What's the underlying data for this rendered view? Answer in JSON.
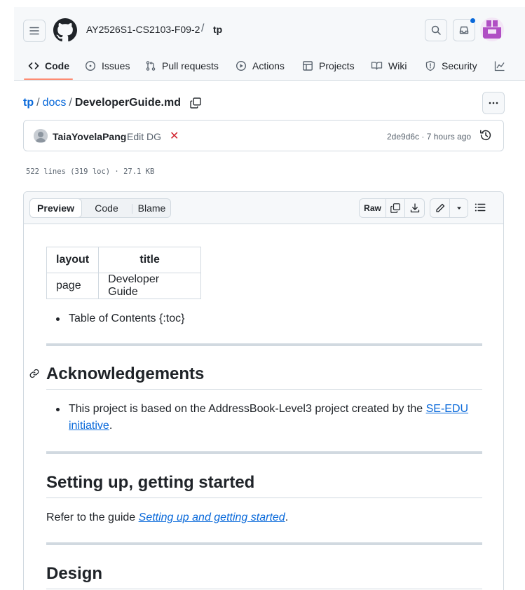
{
  "header": {
    "repo_owner": "AY2526S1-CS2103-F09-2",
    "repo_sep": "/",
    "repo_name": "tp"
  },
  "nav": {
    "tabs": [
      {
        "label": "Code",
        "icon": "code-icon",
        "active": true
      },
      {
        "label": "Issues",
        "icon": "issue-icon"
      },
      {
        "label": "Pull requests",
        "icon": "pull-request-icon"
      },
      {
        "label": "Actions",
        "icon": "play-icon"
      },
      {
        "label": "Projects",
        "icon": "table-icon"
      },
      {
        "label": "Wiki",
        "icon": "book-icon"
      },
      {
        "label": "Security",
        "icon": "shield-icon"
      }
    ]
  },
  "breadcrumb": {
    "root": "tp",
    "sep": "/",
    "folder": "docs",
    "file": "DeveloperGuide.md"
  },
  "commit": {
    "author": "TaiaYovelaPang",
    "message": "Edit DG",
    "status_mark": "✕",
    "meta": "2de9d6c · 7 hours ago"
  },
  "file_meta": "522 lines (319 loc) · 27.1 KB",
  "viewer": {
    "tabs": [
      "Preview",
      "Code",
      "Blame"
    ],
    "raw_label": "Raw"
  },
  "markdown": {
    "frontmatter": {
      "headers": [
        "layout",
        "title"
      ],
      "row": [
        "page",
        "Developer Guide"
      ]
    },
    "toc_item": "Table of Contents {:toc}",
    "sections": {
      "ack": {
        "heading": "Acknowledgements",
        "item_prefix": "This project is based on the AddressBook-Level3 project created by the ",
        "item_link_1": "SE-EDU",
        "item_link_2": "initiative",
        "item_suffix": "."
      },
      "setup": {
        "heading": "Setting up, getting started",
        "para_prefix": "Refer to the guide ",
        "para_link": "Setting up and getting started",
        "para_suffix": "."
      },
      "design": {
        "heading": "Design"
      }
    }
  },
  "colors": {
    "accent": "#0969da",
    "nav_underline": "#fd8c73",
    "fail": "#d1242f",
    "avatar": "#b04fc4"
  }
}
